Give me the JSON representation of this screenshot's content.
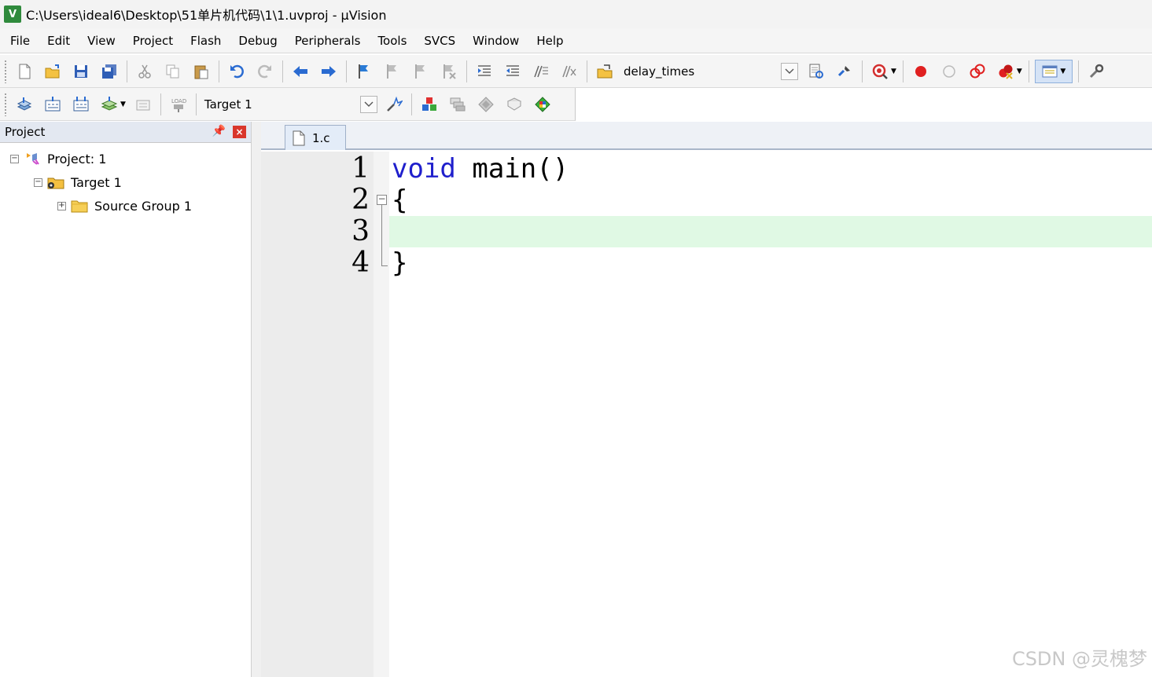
{
  "window": {
    "title": "C:\\Users\\ideal6\\Desktop\\51单片机代码\\1\\1.uvproj - µVision",
    "app_icon_text": "V"
  },
  "menu": [
    "File",
    "Edit",
    "View",
    "Project",
    "Flash",
    "Debug",
    "Peripherals",
    "Tools",
    "SVCS",
    "Window",
    "Help"
  ],
  "toolbar1": {
    "find_combo_value": "delay_times"
  },
  "toolbar2": {
    "target_combo_value": "Target 1"
  },
  "project_panel": {
    "title": "Project",
    "tree": [
      {
        "label": "Project: 1",
        "expander": "−"
      },
      {
        "label": "Target 1",
        "expander": "−"
      },
      {
        "label": "Source Group 1",
        "expander": "+"
      }
    ]
  },
  "editor": {
    "tab_label": "1.c",
    "lines": [
      {
        "number": "1",
        "keyword": "void",
        "rest": " main()"
      },
      {
        "number": "2",
        "keyword": "",
        "rest": "{"
      },
      {
        "number": "3",
        "keyword": "",
        "rest": ""
      },
      {
        "number": "4",
        "keyword": "",
        "rest": "}"
      }
    ],
    "current_line_color": "#e0f9e4",
    "keyword_color": "#1f1fcc"
  },
  "watermark": "CSDN @灵槐梦"
}
